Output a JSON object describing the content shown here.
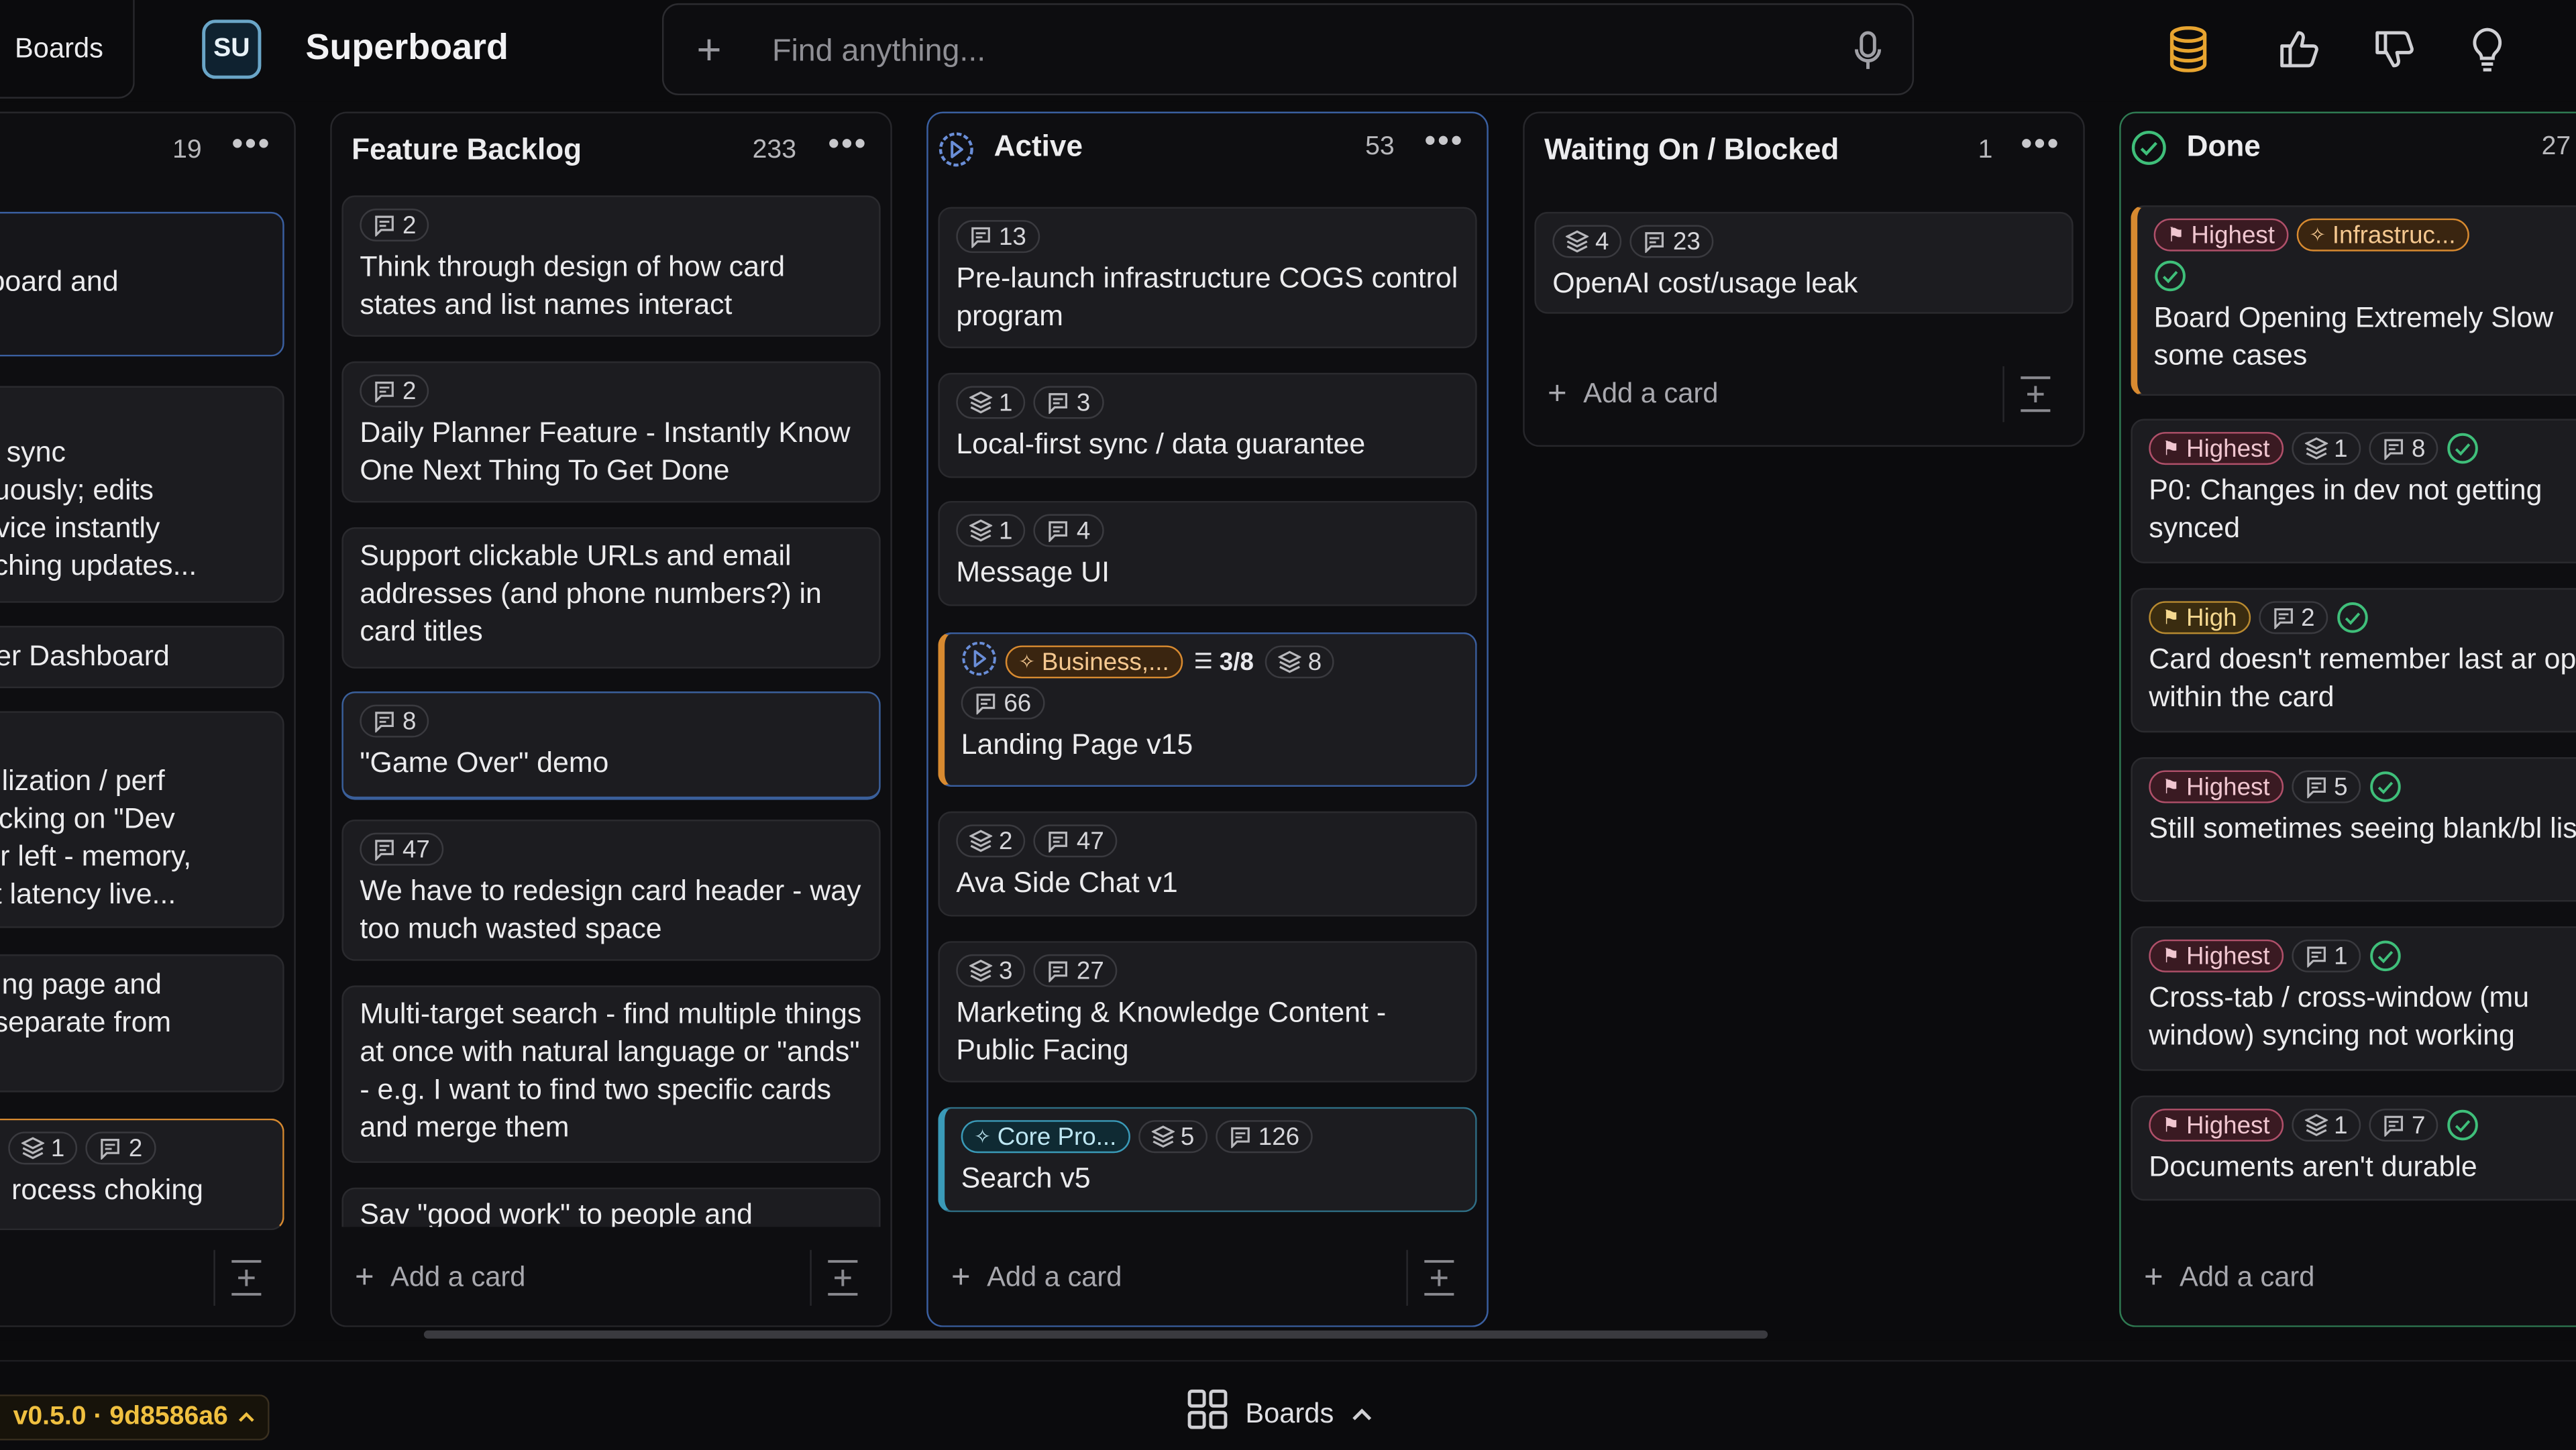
{
  "header": {
    "boards_label": "Boards",
    "avatar_initials": "SU",
    "app_title": "Superboard",
    "search_placeholder": "Find anything..."
  },
  "columns": [
    {
      "title": "",
      "count": "19",
      "cards": [
        {
          "title": "perboard and",
          "badges": []
        },
        {
          "title": "way sync\nntinuously; edits\n, device instantly\necaching updates...",
          "badges": []
        },
        {
          "title": "under Dashboard",
          "badges": []
        },
        {
          "title": "e utilization / perf\nn clicking on \"Dev\nower left - memory,\nuest latency live...",
          "badges": []
        },
        {
          "title": "anding page and\ntes separate from",
          "badges": []
        },
        {
          "title": "rocess choking",
          "badges": [
            {
              "type": "layers",
              "text": "1"
            },
            {
              "type": "comments",
              "text": "2"
            }
          ]
        }
      ],
      "add_label": ""
    },
    {
      "title": "Feature Backlog",
      "count": "233",
      "cards": [
        {
          "title": "Think through design of how card states and list names interact",
          "badges": [
            {
              "type": "comments",
              "text": "2"
            }
          ]
        },
        {
          "title": "Daily Planner Feature - Instantly Know One Next Thing To Get Done",
          "badges": [
            {
              "type": "comments",
              "text": "2"
            }
          ]
        },
        {
          "title": "Support clickable URLs and email addresses (and phone numbers?) in card titles",
          "badges": []
        },
        {
          "title": "\"Game Over\" demo",
          "badges": [
            {
              "type": "comments",
              "text": "8"
            }
          ]
        },
        {
          "title": "We have to redesign card header - way too much wasted space",
          "badges": [
            {
              "type": "comments",
              "text": "47"
            }
          ]
        },
        {
          "title": "Multi-target search - find multiple things at once with natural language or \"ands\" - e.g. I want to find two specific cards and merge them",
          "badges": []
        },
        {
          "title": "Sav \"good work\" to people and",
          "badges": []
        }
      ],
      "add_label": "Add a card"
    },
    {
      "title": "Active",
      "count": "53",
      "cards": [
        {
          "title": "Pre-launch infrastructure COGS control program",
          "badges": [
            {
              "type": "comments",
              "text": "13"
            }
          ]
        },
        {
          "title": "Local-first sync / data guarantee",
          "badges": [
            {
              "type": "layers",
              "text": "1"
            },
            {
              "type": "comments",
              "text": "3"
            }
          ]
        },
        {
          "title": "Message UI",
          "badges": [
            {
              "type": "layers",
              "text": "1"
            },
            {
              "type": "comments",
              "text": "4"
            }
          ]
        },
        {
          "title": "Landing Page v15",
          "badges": [
            {
              "type": "tag",
              "text": "Business,..."
            },
            {
              "type": "checklist",
              "text": "3/8"
            },
            {
              "type": "layers",
              "text": "8"
            },
            {
              "type": "comments",
              "text": "66"
            }
          ]
        },
        {
          "title": "Ava Side Chat v1",
          "badges": [
            {
              "type": "layers",
              "text": "2"
            },
            {
              "type": "comments",
              "text": "47"
            }
          ]
        },
        {
          "title": "Marketing & Knowledge Content - Public Facing",
          "badges": [
            {
              "type": "layers",
              "text": "3"
            },
            {
              "type": "comments",
              "text": "27"
            }
          ]
        },
        {
          "title": "Search v5",
          "badges": [
            {
              "type": "tag",
              "text": "Core Pro..."
            },
            {
              "type": "layers",
              "text": "5"
            },
            {
              "type": "comments",
              "text": "126"
            }
          ]
        }
      ],
      "add_label": "Add a card"
    },
    {
      "title": "Waiting On / Blocked",
      "count": "1",
      "cards": [
        {
          "title": "OpenAI cost/usage leak",
          "badges": [
            {
              "type": "layers",
              "text": "4"
            },
            {
              "type": "comments",
              "text": "23"
            }
          ]
        }
      ],
      "add_label": "Add a card"
    },
    {
      "title": "Done",
      "count": "27",
      "cards": [
        {
          "title": "Board Opening Extremely Slow some cases",
          "badges": [
            {
              "type": "priority",
              "text": "Highest"
            },
            {
              "type": "tag",
              "text": "Infrastruc..."
            }
          ]
        },
        {
          "title": "P0: Changes in dev not getting synced",
          "badges": [
            {
              "type": "priority",
              "text": "Highest"
            },
            {
              "type": "layers",
              "text": "1"
            },
            {
              "type": "comments",
              "text": "8"
            }
          ]
        },
        {
          "title": "Card doesn't remember last ar open within the card",
          "badges": [
            {
              "type": "priority",
              "text": "High"
            },
            {
              "type": "comments",
              "text": "2"
            }
          ]
        },
        {
          "title": "Still sometimes seeing blank/bl lists",
          "badges": [
            {
              "type": "priority",
              "text": "Highest"
            },
            {
              "type": "comments",
              "text": "5"
            }
          ]
        },
        {
          "title": "Cross-tab / cross-window (mu window) syncing not working",
          "badges": [
            {
              "type": "priority",
              "text": "Highest"
            },
            {
              "type": "comments",
              "text": "1"
            }
          ]
        },
        {
          "title": "Documents aren't durable",
          "badges": [
            {
              "type": "priority",
              "text": "Highest"
            },
            {
              "type": "layers",
              "text": "1"
            },
            {
              "type": "comments",
              "text": "7"
            }
          ]
        }
      ],
      "add_label": "Add a card"
    }
  ],
  "footer": {
    "version": "v0.5.0 · 9d8586a6",
    "boards_tab_label": "Boards"
  },
  "colors": {
    "accent_active": "#3a5fa0",
    "accent_done": "#2f7a52",
    "priority_highest": "#b0506a",
    "priority_high": "#b88a30",
    "version_text": "#f0c040"
  }
}
